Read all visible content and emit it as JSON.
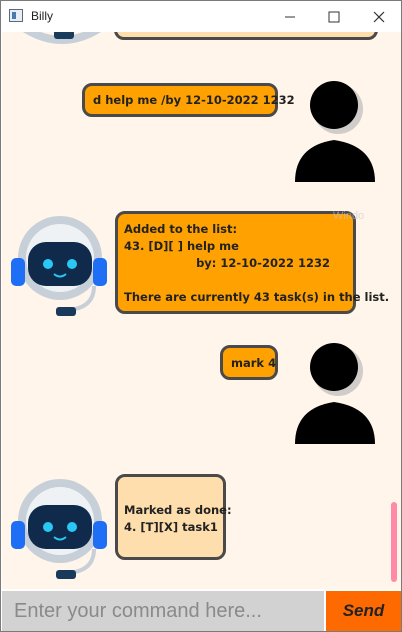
{
  "window": {
    "title": "Billy"
  },
  "messages": [
    {
      "sender": "bot",
      "text": ""
    },
    {
      "sender": "user",
      "text": "d help me /by 12-10-2022 1232"
    },
    {
      "sender": "bot",
      "text": "Added to the list:\n43. [D][ ] help me\n                  by: 12-10-2022 1232\n\nThere are currently 43 task(s) in the list."
    },
    {
      "sender": "user",
      "text": "mark 4"
    },
    {
      "sender": "bot",
      "text": "Marked as done:\n4. [T][X] task1"
    }
  ],
  "input": {
    "placeholder": "Enter your command here...",
    "value": ""
  },
  "send_label": "Send",
  "overlay_text": "Windo",
  "colors": {
    "chat_bg": "#fff5ea",
    "user_bubble": "#ffa100",
    "bot_bubble_new": "#ffa100",
    "bot_bubble_old": "#ffdead",
    "send_button": "#ff6a00",
    "input_bg": "#d2d2d2"
  },
  "icons": {
    "app": "window-icon",
    "minimize": "minimize-icon",
    "maximize": "maximize-icon",
    "close": "close-icon",
    "user": "user-avatar-icon",
    "bot": "robot-avatar-icon"
  }
}
